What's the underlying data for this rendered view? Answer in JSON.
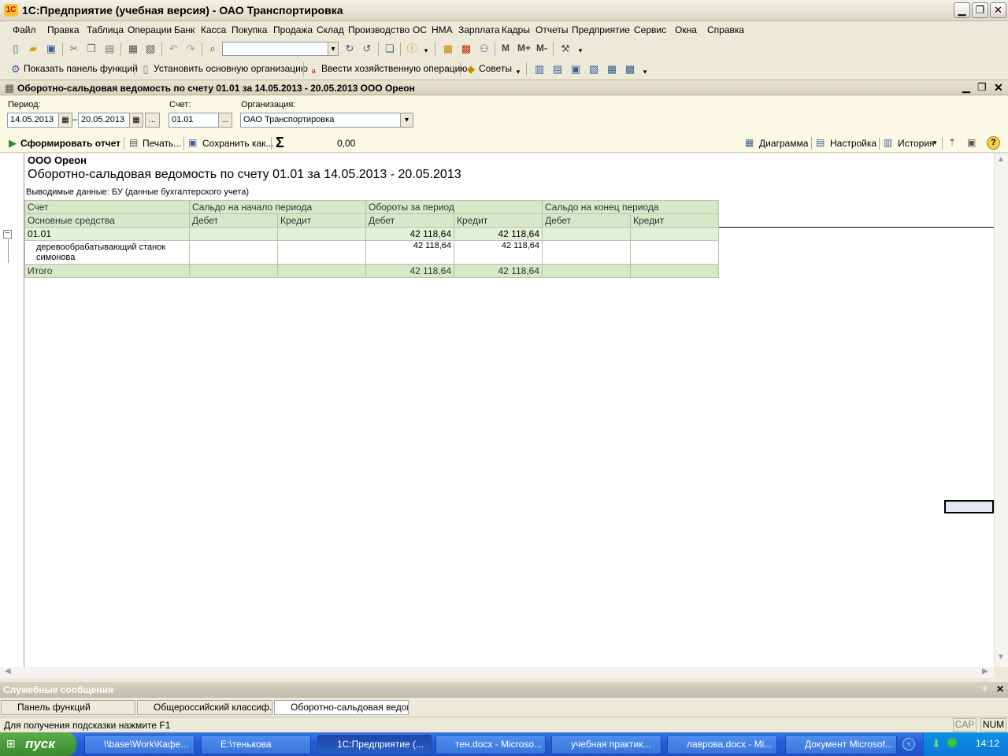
{
  "app": {
    "title": "1С:Предприятие (учебная версия) - ОАО Транспортировка",
    "logo": "1С"
  },
  "window_buttons": {
    "minimize": "▁",
    "restore": "❐",
    "close": "✕"
  },
  "menu": [
    "Файл",
    "Правка",
    "Таблица",
    "Операции",
    "Банк",
    "Касса",
    "Покупка",
    "Продажа",
    "Склад",
    "Производство",
    "ОС",
    "НМА",
    "Зарплата",
    "Кадры",
    "Отчеты",
    "Предприятие",
    "Сервис",
    "Окна",
    "Справка"
  ],
  "toolbar2": {
    "show_panel": "Показать панель функций",
    "set_org": "Установить основную организацию",
    "enter_op": "Ввести хозяйственную операцию",
    "tips": "Советы",
    "m": "M",
    "mplus": "M+",
    "mminus": "M-"
  },
  "document": {
    "title": "Оборотно-сальдовая ведомость по счету 01.01 за 14.05.2013 - 20.05.2013 ООО Ореон",
    "period_label": "Период:",
    "period_from": "14.05.2013",
    "period_dash": "–",
    "period_to": "20.05.2013",
    "period_btn": "...",
    "account_label": "Счет:",
    "account_value": "01.01",
    "account_btn": "...",
    "org_label": "Организация:",
    "org_value": "ОАО Транспортировка"
  },
  "commands": {
    "generate": "Сформировать отчет",
    "print": "Печать...",
    "save_as": "Сохранить как...",
    "sum_symbol": "Σ",
    "sum_value": "0,00",
    "chart": "Диаграмма",
    "settings": "Настройка",
    "history": "История",
    "help": "?"
  },
  "report": {
    "company": "ООО Ореон",
    "title": "Оборотно-сальдовая ведомость по счету 01.01 за 14.05.2013 - 20.05.2013",
    "output_data": "Выводимые данные:  БУ (данные бухгалтерского учета)",
    "header1": [
      "Счет",
      "Сальдо на начало периода",
      "Обороты за период",
      "Сальдо на конец периода"
    ],
    "header2": [
      "Основные средства",
      "Дебет",
      "Кредит",
      "Дебет",
      "Кредит",
      "Дебет",
      "Кредит"
    ],
    "group_row": {
      "account": "01.01",
      "start_debit": "",
      "start_credit": "",
      "turn_debit": "42 118,64",
      "turn_credit": "42 118,64",
      "end_debit": "",
      "end_credit": ""
    },
    "detail_row": {
      "account": "деревообрабатывающий станок симонова",
      "turn_debit": "42 118,64",
      "turn_credit": "42 118,64"
    },
    "total_row": {
      "account": "Итого",
      "turn_debit": "42 118,64",
      "turn_credit": "42 118,64"
    },
    "collapse": "−"
  },
  "service": {
    "title": "Служебные сообщения",
    "pin": "ᵠ",
    "close": "✕"
  },
  "window_tabs": [
    "Панель функций",
    "Общероссийский классиф...",
    "Оборотно-сальдовая ведом..."
  ],
  "status": {
    "hint": "Для получения подсказки нажмите F1",
    "cap": "CAP",
    "num": "NUM"
  },
  "taskbar": {
    "start": "пуск",
    "tasks": [
      "\\\\base\\Work\\Кафе...",
      "E:\\тенькова",
      "1С:Предприятие (...",
      "тен.docx - Microso...",
      "учебная практик...",
      "лаврова.docx - Mi...",
      "Документ Microsof..."
    ],
    "clock": "14:12"
  }
}
